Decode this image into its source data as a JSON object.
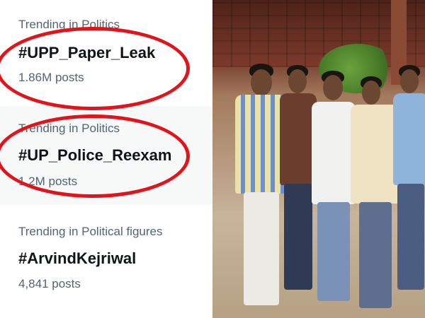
{
  "colors": {
    "highlight_circle": "#e3131b",
    "text_primary": "#0f1419",
    "text_secondary": "#536471"
  },
  "trends": [
    {
      "context": "Trending in Politics",
      "name": "#UPP_Paper_Leak",
      "posts": "1.86M posts",
      "circled": true
    },
    {
      "context": "Trending in Politics",
      "name": "#UP_Police_Reexam",
      "posts": "1.2M posts",
      "circled": true
    },
    {
      "context": "Trending in Political figures",
      "name": "#ArvindKejriwal",
      "posts": "4,841 posts",
      "circled": false
    }
  ],
  "photo": {
    "description_icon": "crowd-photo"
  }
}
